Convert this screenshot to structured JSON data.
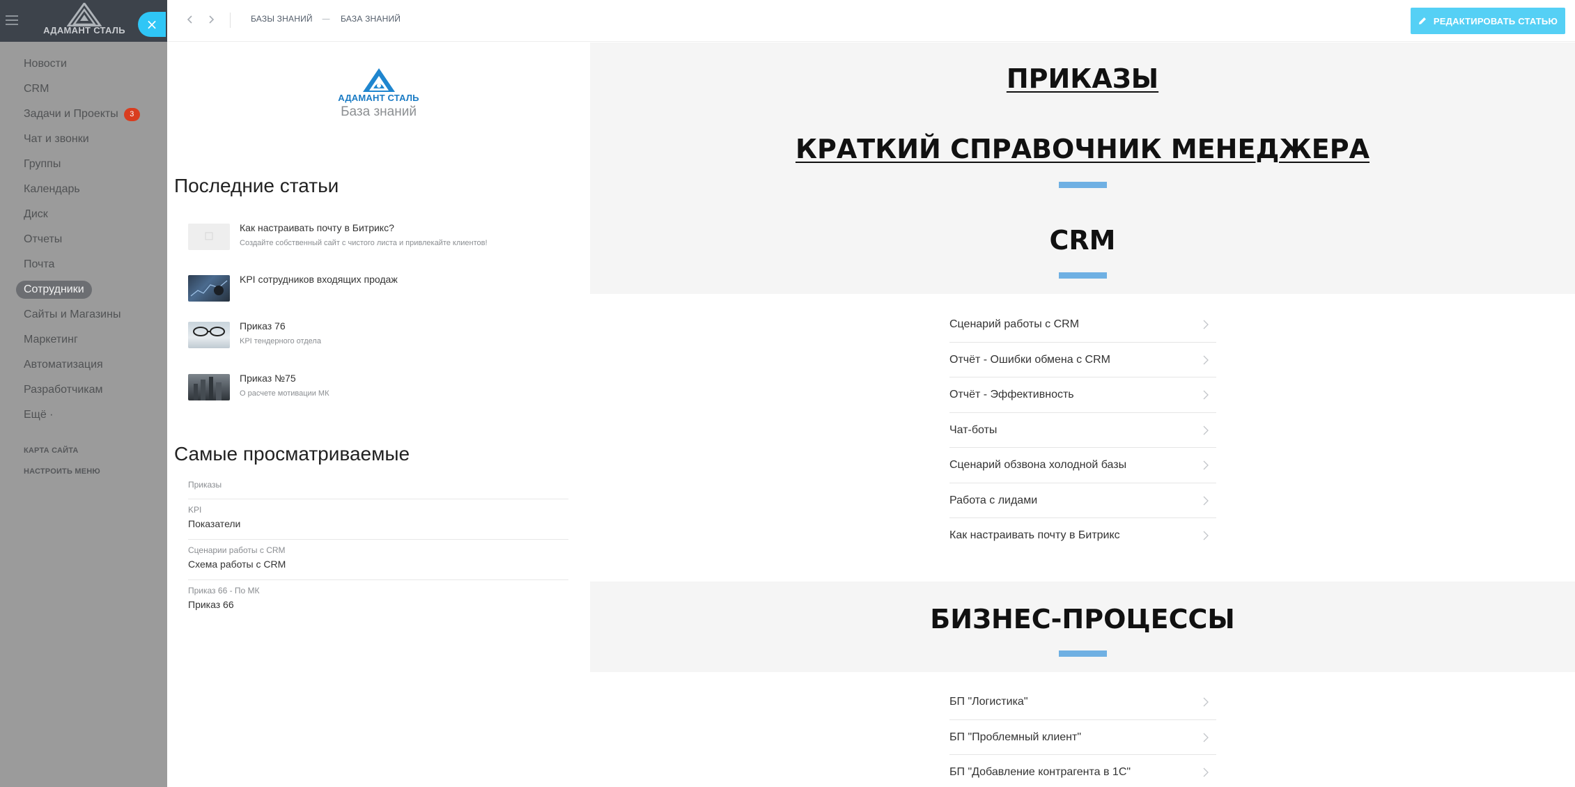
{
  "nav": {
    "brand": "АДАМАНТ СТАЛЬ",
    "items": [
      {
        "label": "Новости"
      },
      {
        "label": "CRM"
      },
      {
        "label": "Задачи и Проекты",
        "counter": "3"
      },
      {
        "label": "Чат и звонки"
      },
      {
        "label": "Группы"
      },
      {
        "label": "Календарь"
      },
      {
        "label": "Диск"
      },
      {
        "label": "Отчеты"
      },
      {
        "label": "Почта"
      },
      {
        "label": "Сотрудники"
      },
      {
        "label": "Сайты и Магазины"
      },
      {
        "label": "Маркетинг"
      },
      {
        "label": "Автоматизация"
      },
      {
        "label": "Разработчикам"
      },
      {
        "label": "Ещё ·"
      }
    ],
    "sitemap": "КАРТА САЙТА",
    "configure": "НАСТРОИТЬ МЕНЮ"
  },
  "header": {
    "breadcrumb": [
      "БАЗЫ ЗНАНИЙ",
      "БАЗА ЗНАНИЙ"
    ],
    "edit_label": "РЕДАКТИРОВАТЬ СТАТЬЮ"
  },
  "kb": {
    "brand": "АДАМАНТ СТАЛЬ",
    "subtitle": "База знаний",
    "recent_title": "Последние статьи",
    "recent": [
      {
        "title": "Как настраивать почту в Битрикс?",
        "desc": "Создайте собственный сайт с чистого листа и привлекайте клиентов!"
      },
      {
        "title": "KPI сотрудников входящих продаж",
        "desc": ""
      },
      {
        "title": "Приказ 76",
        "desc": "KPI тендерного отдела"
      },
      {
        "title": "Приказ №75",
        "desc": "О расчете мотивации МК"
      }
    ],
    "popular_title": "Самые просматриваемые",
    "popular": [
      {
        "category": "Приказы",
        "title": ""
      },
      {
        "category": "KPI",
        "title": "Показатели"
      },
      {
        "category": "Сценарии работы с CRM",
        "title": "Схема работы с CRM"
      },
      {
        "category": "Приказ 66 - По МК",
        "title": "Приказ 66"
      }
    ]
  },
  "main": {
    "link1": "ПРИКАЗЫ",
    "link2": "КРАТКИЙ СПРАВОЧНИК МЕНЕДЖЕРА",
    "crm_title": "CRM",
    "crm_items": [
      "Сценарий работы с CRM",
      "Отчёт - Ошибки обмена с CRM",
      "Отчёт - Эффективность",
      "Чат-боты",
      "Сценарий обзвона холодной базы",
      "Работа с лидами",
      "Как настраивать почту в Битрикс"
    ],
    "bp_title": "БИЗНЕС-ПРОЦЕССЫ",
    "bp_items": [
      "БП \"Логистика\"",
      "БП \"Проблемный клиент\"",
      "БП \"Добавление контрагента в 1С\""
    ]
  },
  "colors": {
    "accent": "#55d0f5",
    "accent_bar": "#6fb0e3",
    "counter": "#d93d1f",
    "brand_blue": "#1a7bc4"
  }
}
